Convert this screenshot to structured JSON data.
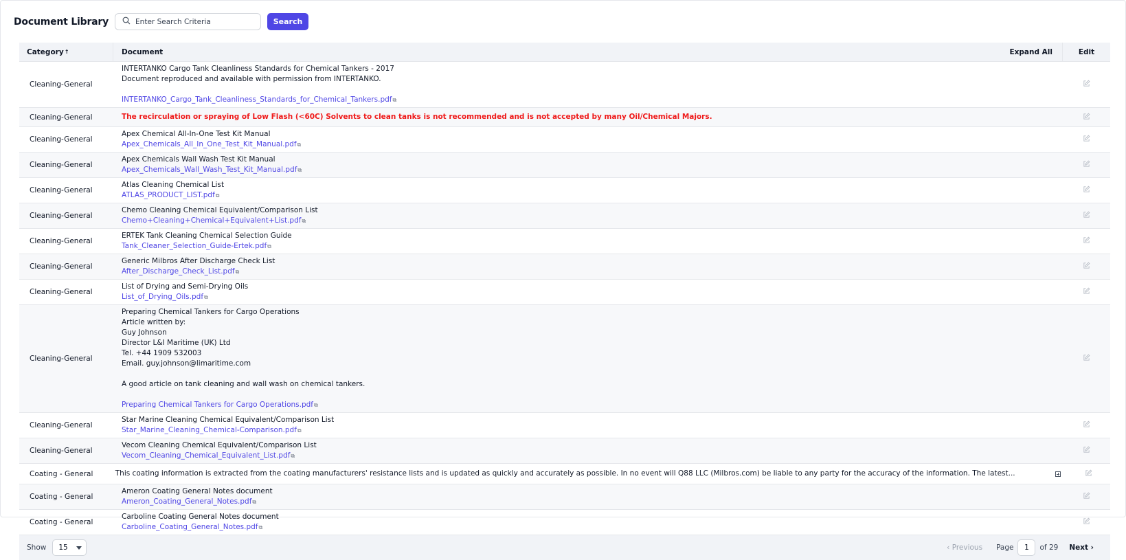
{
  "header": {
    "title": "Document Library",
    "search_placeholder": "Enter Search Criteria",
    "search_button": "Search"
  },
  "table": {
    "columns": {
      "category": "Category",
      "document": "Document",
      "expand_all": "Expand All",
      "edit": "Edit"
    },
    "rows": [
      {
        "category": "Cleaning-General",
        "lines": [
          "INTERTANKO Cargo Tank Cleanliness Standards for Chemical Tankers - 2017",
          "Document reproduced and available with permission from INTERTANKO.",
          ""
        ],
        "link": "INTERTANKO_Cargo_Tank_Cleanliness_Standards_for_Chemical_Tankers.pdf"
      },
      {
        "category": "Cleaning-General",
        "warning": "The recirculation or spraying of Low Flash (<60C) Solvents to clean tanks is not recommended and is not accepted by many Oil/Chemical Majors."
      },
      {
        "category": "Cleaning-General",
        "lines": [
          "Apex Chemical All-In-One Test Kit Manual"
        ],
        "link": "Apex_Chemicals_All_In_One_Test_Kit_Manual.pdf"
      },
      {
        "category": "Cleaning-General",
        "lines": [
          "Apex Chemicals Wall Wash Test Kit Manual"
        ],
        "link": "Apex_Chemicals_Wall_Wash_Test_Kit_Manual.pdf"
      },
      {
        "category": "Cleaning-General",
        "lines": [
          "Atlas Cleaning Chemical List"
        ],
        "link": "ATLAS_PRODUCT_LIST.pdf"
      },
      {
        "category": "Cleaning-General",
        "lines": [
          "Chemo Cleaning Chemical Equivalent/Comparison List"
        ],
        "link": "Chemo+Cleaning+Chemical+Equivalent+List.pdf"
      },
      {
        "category": "Cleaning-General",
        "lines": [
          "ERTEK Tank Cleaning Chemical Selection Guide"
        ],
        "link": "Tank_Cleaner_Selection_Guide-Ertek.pdf"
      },
      {
        "category": "Cleaning-General",
        "lines": [
          "Generic Milbros After Discharge Check List"
        ],
        "link": "After_Discharge_Check_List.pdf"
      },
      {
        "category": "Cleaning-General",
        "lines": [
          "List of Drying and Semi-Drying Oils"
        ],
        "link": "List_of_Drying_Oils.pdf"
      },
      {
        "category": "Cleaning-General",
        "lines": [
          "Preparing Chemical Tankers for Cargo Operations",
          "Article written by:",
          "Guy Johnson",
          "Director L&I Maritime (UK) Ltd",
          "Tel. +44 1909 532003",
          "Email. guy.johnson@limaritime.com",
          "",
          "A good article on tank cleaning and wall wash on chemical tankers.",
          ""
        ],
        "link": "Preparing Chemical Tankers for Cargo Operations.pdf"
      },
      {
        "category": "Cleaning-General",
        "lines": [
          "Star Marine Cleaning Chemical Equivalent/Comparison List"
        ],
        "link": "Star_Marine_Cleaning_Chemical-Comparison.pdf"
      },
      {
        "category": "Cleaning-General",
        "lines": [
          "Vecom Cleaning Chemical Equivalent/Comparison List"
        ],
        "link": "Vecom_Cleaning_Chemical_Equivalent_List.pdf"
      },
      {
        "category": "Coating - General",
        "lines": [
          "This coating information is extracted from the coating manufacturers' resistance lists and is updated as quickly and accurately as possible. In no event will Q88 LLC (Milbros.com) be liable to any party for the accuracy of the information. The latest..."
        ],
        "expandable": true
      },
      {
        "category": "Coating - General",
        "lines": [
          "Ameron Coating General Notes document"
        ],
        "link": "Ameron_Coating_General_Notes.pdf"
      },
      {
        "category": "Coating - General",
        "lines": [
          "Carboline Coating General Notes document"
        ],
        "link": "Carboline_Coating_General_Notes.pdf"
      }
    ]
  },
  "footer": {
    "show_label": "Show",
    "page_size": "15",
    "previous": "Previous",
    "page_label": "Page",
    "page_number": "1",
    "of_label": "of 29",
    "next": "Next"
  },
  "colors": {
    "accent": "#4f46e5",
    "warning": "#ef1b1b",
    "header_bg": "#f1f3f7",
    "alt_row_bg": "#f7f8fa"
  },
  "icons": {
    "search": "search-icon",
    "attachment": "paperclip-icon",
    "edit": "edit-icon",
    "expand": "expand-icon",
    "sort": "sort-up-icon",
    "caret": "chevron-down-icon"
  }
}
